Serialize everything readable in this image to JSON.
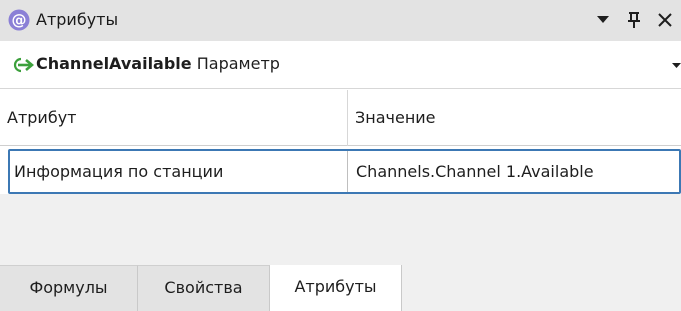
{
  "panel": {
    "title": "Атрибуты",
    "title_icon": "at-sign-icon",
    "controls": [
      "dropdown-arrow-icon",
      "pin-icon",
      "close-icon"
    ],
    "controls_text": {
      "pin": "ᵽ",
      "close": "×"
    }
  },
  "selector": {
    "icon": "green-arrow-icon",
    "name": "ChannelAvailable",
    "type": " Параметр"
  },
  "grid": {
    "headers": {
      "attribute": "Атрибут",
      "value": "Значение"
    },
    "rows": [
      {
        "attribute": "Информация по станции",
        "value": "Channels.Channel 1.Available"
      }
    ]
  },
  "tabs": [
    {
      "label": "Формулы",
      "selected": false
    },
    {
      "label": "Свойства",
      "selected": false
    },
    {
      "label": "Атрибуты",
      "selected": true
    }
  ],
  "colors": {
    "titlebar_bg": "#e3e3e3",
    "row_border": "#3c78b4",
    "arrow_green": "#3ca03c",
    "at_icon_bg": "#8a7fd6"
  }
}
